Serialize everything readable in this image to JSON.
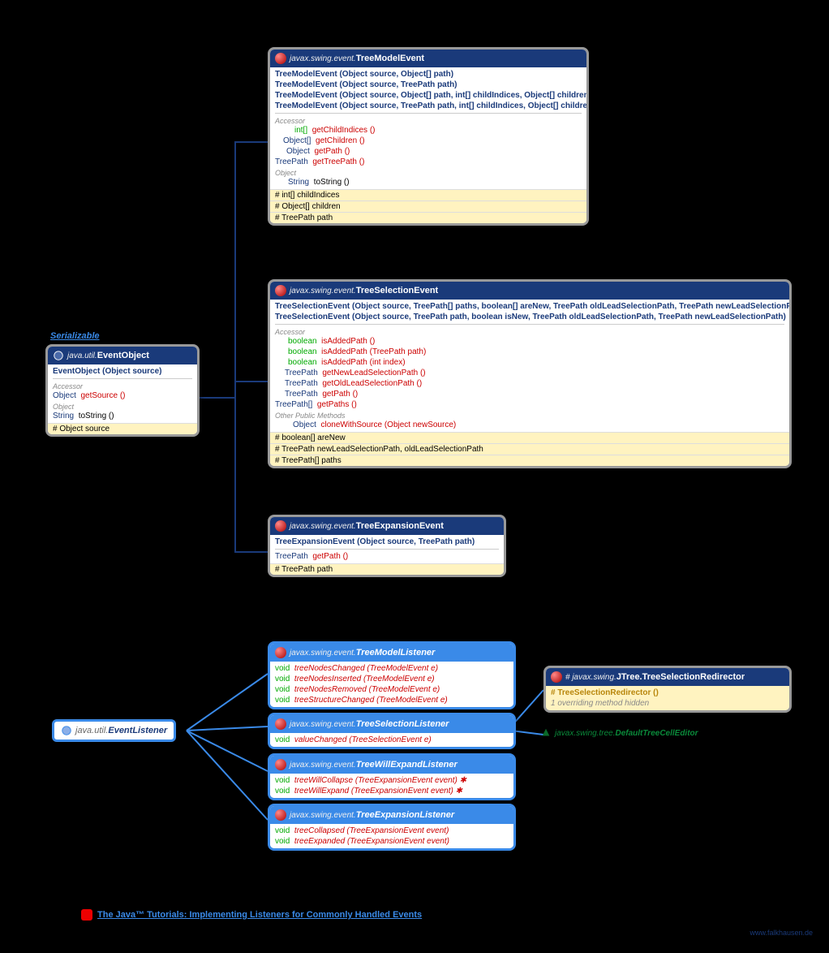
{
  "serializable_label": "Serializable",
  "event_object": {
    "pkg": "java.util.",
    "cls": "EventObject",
    "ctor": "EventObject (Object source)",
    "accessor_label": "Accessor",
    "m1_ret": "Object",
    "m1": "getSource ()",
    "object_label": "Object",
    "m2_ret": "String",
    "m2": "toString ()",
    "f1": "# Object  source"
  },
  "tree_model_event": {
    "pkg": "javax.swing.event.",
    "cls": "TreeModelEvent",
    "c1": "TreeModelEvent (Object source, Object[] path)",
    "c2": "TreeModelEvent (Object source, TreePath path)",
    "c3": "TreeModelEvent (Object source, Object[] path, int[] childIndices, Object[] children)",
    "c4": "TreeModelEvent (Object source, TreePath path, int[] childIndices, Object[] children)",
    "accessor_label": "Accessor",
    "m1_ret": "int[]",
    "m1": "getChildIndices ()",
    "m2_ret": "Object[]",
    "m2": "getChildren ()",
    "m3_ret": "Object",
    "m3": "getPath ()",
    "m4_ret": "TreePath",
    "m4": "getTreePath ()",
    "object_label": "Object",
    "m5_ret": "String",
    "m5": "toString ()",
    "f1": "# int[]  childIndices",
    "f2": "# Object[]  children",
    "f3": "# TreePath  path"
  },
  "tree_selection_event": {
    "pkg": "javax.swing.event.",
    "cls": "TreeSelectionEvent",
    "c1": "TreeSelectionEvent (Object source, TreePath[] paths, boolean[] areNew, TreePath oldLeadSelectionPath, TreePath newLeadSelectionPath)",
    "c2": "TreeSelectionEvent (Object source, TreePath path, boolean isNew, TreePath oldLeadSelectionPath, TreePath newLeadSelectionPath)",
    "accessor_label": "Accessor",
    "m1_ret": "boolean",
    "m1": "isAddedPath ()",
    "m2_ret": "boolean",
    "m2": "isAddedPath (TreePath path)",
    "m3_ret": "boolean",
    "m3": "isAddedPath (int index)",
    "m4_ret": "TreePath",
    "m4": "getNewLeadSelectionPath ()",
    "m5_ret": "TreePath",
    "m5": "getOldLeadSelectionPath ()",
    "m6_ret": "TreePath",
    "m6": "getPath ()",
    "m7_ret": "TreePath[]",
    "m7": "getPaths ()",
    "other_label": "Other Public Methods",
    "m8_ret": "Object",
    "m8": "cloneWithSource (Object newSource)",
    "f1": "# boolean[]  areNew",
    "f2": "# TreePath  newLeadSelectionPath, oldLeadSelectionPath",
    "f3": "# TreePath[]  paths"
  },
  "tree_expansion_event": {
    "pkg": "javax.swing.event.",
    "cls": "TreeExpansionEvent",
    "c1": "TreeExpansionEvent (Object source, TreePath path)",
    "m1_ret": "TreePath",
    "m1": "getPath ()",
    "f1": "# TreePath  path"
  },
  "event_listener": {
    "pkg": "java.util.",
    "cls": "EventListener"
  },
  "tree_model_listener": {
    "pkg": "javax.swing.event.",
    "cls": "TreeModelListener",
    "m1_ret": "void",
    "m1": "treeNodesChanged (TreeModelEvent e)",
    "m2_ret": "void",
    "m2": "treeNodesInserted (TreeModelEvent e)",
    "m3_ret": "void",
    "m3": "treeNodesRemoved (TreeModelEvent e)",
    "m4_ret": "void",
    "m4": "treeStructureChanged (TreeModelEvent e)"
  },
  "tree_selection_listener": {
    "pkg": "javax.swing.event.",
    "cls": "TreeSelectionListener",
    "m1_ret": "void",
    "m1": "valueChanged (TreeSelectionEvent e)"
  },
  "tree_will_expand_listener": {
    "pkg": "javax.swing.event.",
    "cls": "TreeWillExpandListener",
    "m1_ret": "void",
    "m1": "treeWillCollapse (TreeExpansionEvent event) ✱",
    "m2_ret": "void",
    "m2": "treeWillExpand (TreeExpansionEvent event) ✱"
  },
  "tree_expansion_listener": {
    "pkg": "javax.swing.event.",
    "cls": "TreeExpansionListener",
    "m1_ret": "void",
    "m1": "treeCollapsed (TreeExpansionEvent event)",
    "m2_ret": "void",
    "m2": "treeExpanded (TreeExpansionEvent event)"
  },
  "redirector": {
    "pkg": "# javax.swing.",
    "cls": "JTree.TreeSelectionRedirector",
    "c1": "# TreeSelectionRedirector ()",
    "note": "1 overriding method hidden"
  },
  "default_editor": {
    "pkg": "javax.swing.tree.",
    "cls": "DefaultTreeCellEditor"
  },
  "tutorial_link": "The Java™ Tutorials: Implementing Listeners for Commonly Handled Events",
  "footer": "www.falkhausen.de"
}
